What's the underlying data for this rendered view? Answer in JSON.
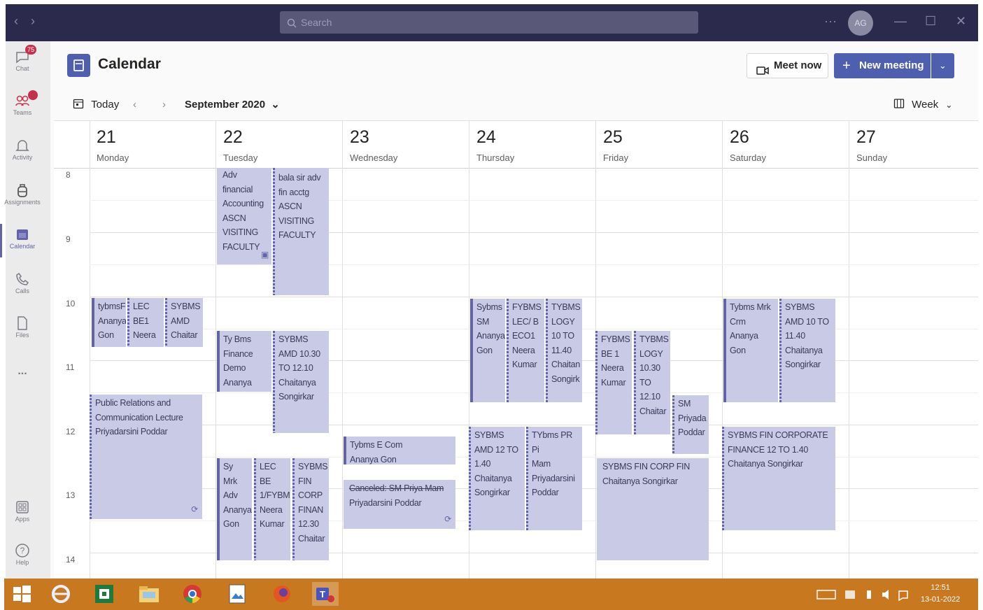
{
  "titlebar": {
    "search_placeholder": "Search",
    "avatar_initials": "AG",
    "more": "···"
  },
  "rail": {
    "chat": {
      "label": "Chat",
      "badge": "75"
    },
    "teams": {
      "label": "Teams"
    },
    "activity": {
      "label": "Activity"
    },
    "assignments": {
      "label": "Assignments"
    },
    "calendar": {
      "label": "Calendar"
    },
    "calls": {
      "label": "Calls"
    },
    "files": {
      "label": "Files"
    },
    "more": {
      "label": "..."
    },
    "apps": {
      "label": "Apps"
    },
    "help": {
      "label": "Help"
    }
  },
  "header": {
    "title": "Calendar",
    "meet_now": "Meet now",
    "new_meeting": "New meeting"
  },
  "toolbar": {
    "today": "Today",
    "month": "September 2020",
    "view": "Week"
  },
  "days": [
    {
      "num": "21",
      "name": "Monday"
    },
    {
      "num": "22",
      "name": "Tuesday"
    },
    {
      "num": "23",
      "name": "Wednesday"
    },
    {
      "num": "24",
      "name": "Thursday"
    },
    {
      "num": "25",
      "name": "Friday"
    },
    {
      "num": "26",
      "name": "Saturday"
    },
    {
      "num": "27",
      "name": "Sunday"
    }
  ],
  "hours": [
    "8",
    "9",
    "10",
    "11",
    "12",
    "13",
    "14"
  ],
  "events": {
    "tue_adv": {
      "title": "Adv\nfinancial\nAccounting",
      "org": "ASCN\nVISITING\nFACULTY"
    },
    "tue_bala": {
      "title": "bala sir adv\nfin acctg",
      "org": "ASCN\nVISITING\nFACULTY"
    },
    "mon_tybms": {
      "title": "tybmsF",
      "org": "Ananya\nGon"
    },
    "mon_lec": {
      "title": "LEC\nBE1",
      "org": "Neera"
    },
    "mon_sybms": {
      "title": "SYBMS\nAMD",
      "org": "Chaitar"
    },
    "mon_pr": {
      "title": "Public Relations and\nCommunication Lecture",
      "org": "Priyadarsini Poddar"
    },
    "tue_tybms": {
      "title": "Ty Bms\nFinance\nDemo",
      "org": "Ananya Gon"
    },
    "tue_sybms": {
      "title": "SYBMS\nAMD 10.30\nTO 12.10",
      "org": "Chaitanya\nSongirkar"
    },
    "tue_symrk": {
      "title": "Sy Mrk\nAdv",
      "org": "Ananya\nGon"
    },
    "tue_lecbe": {
      "title": "LEC BE\n1/FYBM",
      "org": "Neera\nKumar"
    },
    "tue_sybmsfin": {
      "title": "SYBMS\nFIN\nCORP\nFINAN\n12.30",
      "org": "Chaitar"
    },
    "wed_tybms": {
      "title": "Tybms E Com",
      "org": "Ananya Gon"
    },
    "wed_cancel": {
      "title": "Canceled: SM Priya Mam",
      "org": "Priyadarsini Poddar"
    },
    "thu_sybms": {
      "title": "Sybms\nSM",
      "org": "Ananya\nGon"
    },
    "thu_fybms": {
      "title": "FYBMS\nLEC/ B\nECO1",
      "org": "Neera\nKumar"
    },
    "thu_tybms": {
      "title": "TYBMS\nLOGY\n10 TO\n11.40",
      "org": "Chaitan\nSongirk"
    },
    "thu_sybms2": {
      "title": "SYBMS\nAMD 12 TO\n1.40",
      "org": "Chaitanya\nSongirkar"
    },
    "thu_tybmspr": {
      "title": "TYbms PR Pi\nMam",
      "org": "Priyadarsini\nPoddar"
    },
    "fri_fybms": {
      "title": "FYBMS\nBE 1",
      "org": "Neera\nKumar"
    },
    "fri_tybms": {
      "title": "TYBMS\nLOGY\n10.30\nTO\n12.10",
      "org": "Chaitar"
    },
    "fri_sm": {
      "title": "SM",
      "org": "Priyada\nPoddar"
    },
    "fri_fin": {
      "title": "SYBMS FIN CORP FIN",
      "org": "Chaitanya Songirkar"
    },
    "sat_tybms": {
      "title": "Tybms Mrk\nCrm",
      "org": "Ananya Gon"
    },
    "sat_sybms": {
      "title": "SYBMS\nAMD 10 TO\n11.40",
      "org": "Chaitanya\nSongirkar"
    },
    "sat_fin": {
      "title": "SYBMS FIN CORPORATE\nFINANCE 12 TO 1.40",
      "org": "Chaitanya Songirkar"
    }
  },
  "taskbar": {
    "time": "12:51",
    "date": "13-01-2022"
  }
}
